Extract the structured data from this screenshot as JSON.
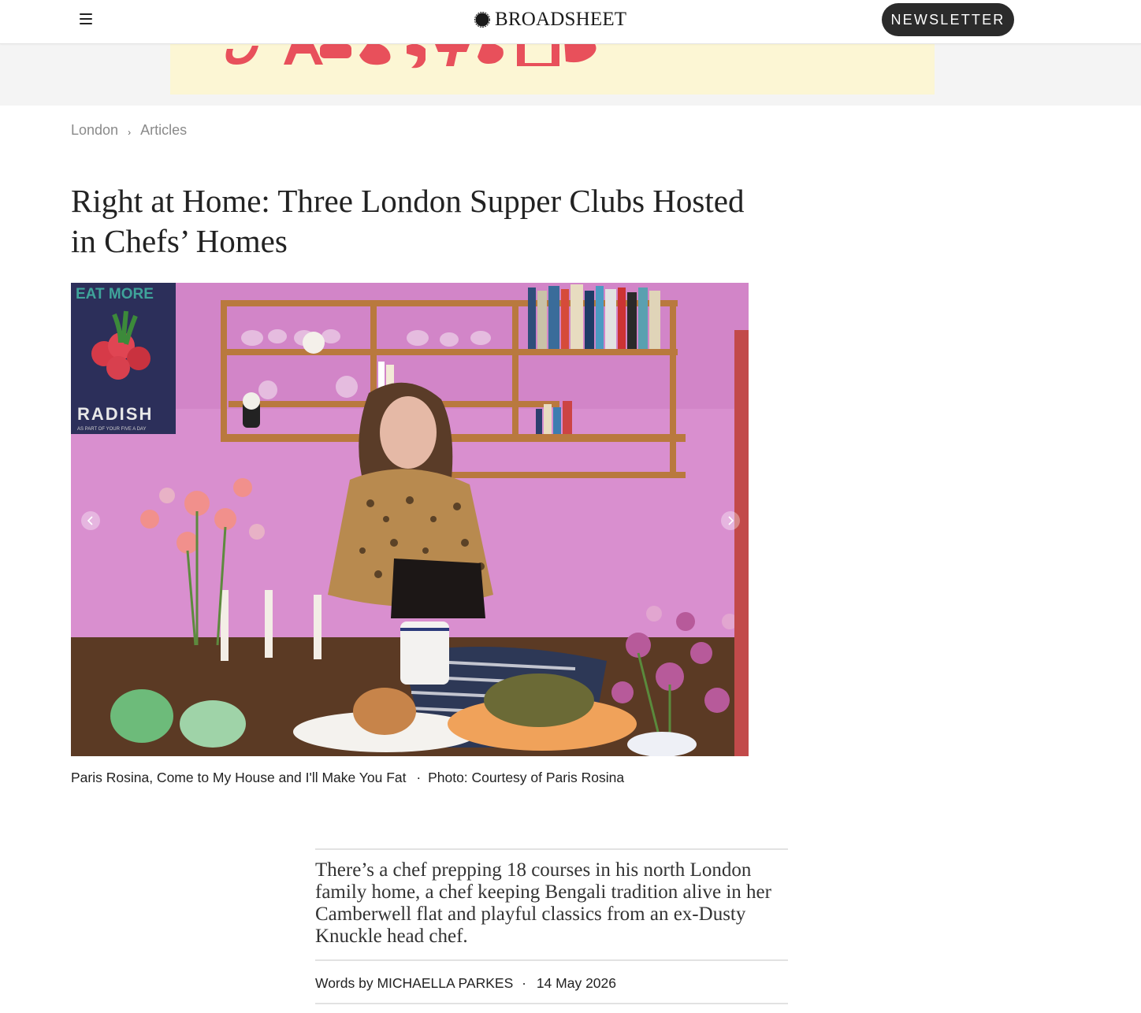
{
  "header": {
    "logo_text": "BROADSHEET",
    "newsletter_label": "NEWSLETTER"
  },
  "breadcrumb": {
    "items": [
      "London",
      "Articles"
    ],
    "separator": "›"
  },
  "article": {
    "title": "Right at Home: Three London Supper Clubs Hosted in Chefs’ Homes",
    "photo": {
      "poster_top_text": "EAT MORE",
      "poster_main_text": "RADISH",
      "poster_small_text": "AS PART OF YOUR FIVE A DAY"
    },
    "caption": "Paris Rosina, Come to My House and I'll Make You Fat",
    "photo_credit": "Photo: Courtesy of Paris Rosina",
    "standfirst": "There’s a chef prepping 18 courses in his north London family home, a chef keeping Bengali tradition alive in her Camberwell flat and playful classics from an ex-Dusty Knuckle head chef.",
    "byline_prefix": "Words by",
    "author": "MICHAELLA PARKES",
    "date": "14 May 2026"
  },
  "colors": {
    "ad_background": "#fcf6d4",
    "ad_accent": "#e8505b",
    "button_background": "#2b2b2b",
    "photo_wall": "#d98fcf"
  },
  "icons": {
    "menu": "hamburger-menu-icon",
    "logo": "broadsheet-logo-icon",
    "prev": "chevron-left-icon",
    "next": "chevron-right-icon"
  }
}
